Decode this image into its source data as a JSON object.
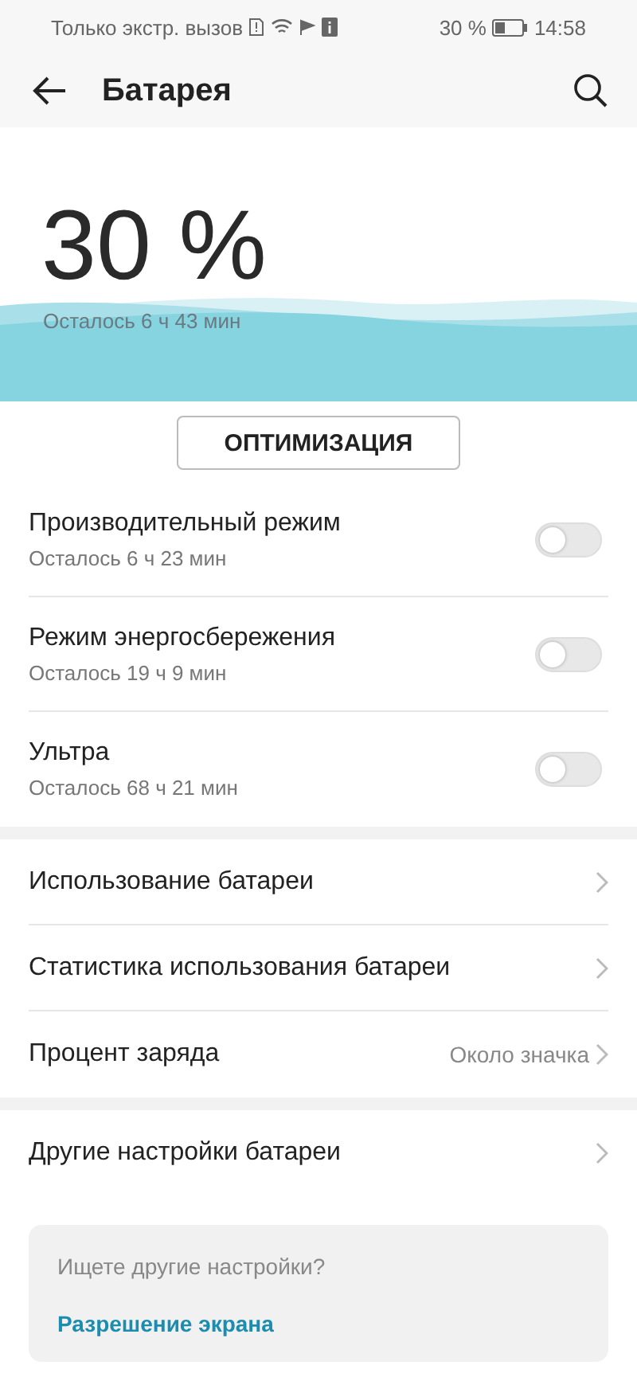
{
  "status_bar": {
    "carrier": "Только экстр. вызов",
    "battery": "30 %",
    "time": "14:58"
  },
  "header": {
    "title": "Батарея"
  },
  "hero": {
    "percent": "30 %",
    "remaining": "Осталось 6 ч 43 мин"
  },
  "optimize_button": "ОПТИМИЗАЦИЯ",
  "modes": [
    {
      "title": "Производительный режим",
      "subtitle": "Осталось 6 ч 23 мин",
      "on": false
    },
    {
      "title": "Режим энергосбережения",
      "subtitle": "Осталось 19 ч 9 мин",
      "on": false
    },
    {
      "title": "Ультра",
      "subtitle": "Осталось 68 ч 21 мин",
      "on": false
    }
  ],
  "nav_items": [
    {
      "title": "Использование батареи"
    },
    {
      "title": "Статистика использования батареи"
    },
    {
      "title": "Процент заряда",
      "value": "Около значка"
    }
  ],
  "other_items": [
    {
      "title": "Другие настройки батареи"
    }
  ],
  "suggestion": {
    "question": "Ищете другие настройки?",
    "link": "Разрешение экрана"
  }
}
